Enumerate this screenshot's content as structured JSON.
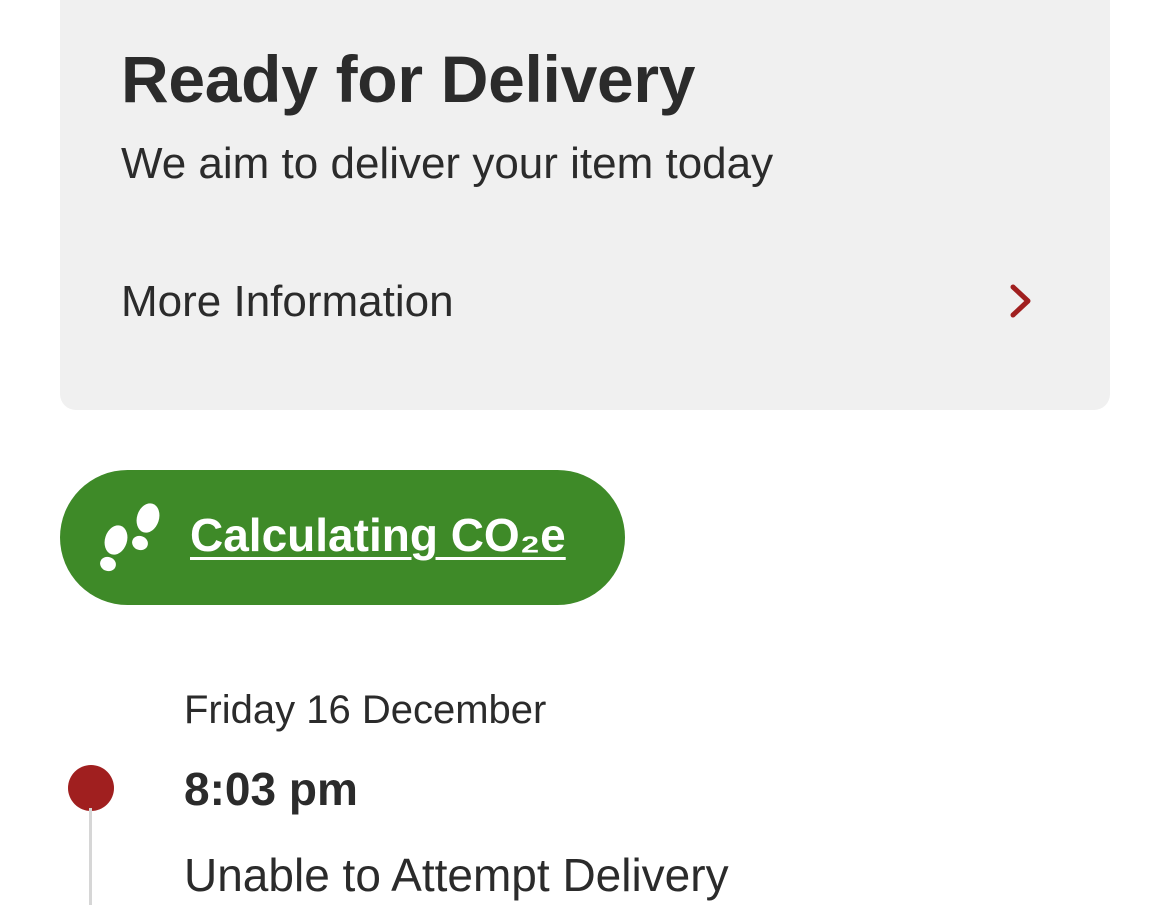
{
  "status_card": {
    "title": "Ready for Delivery",
    "subtitle": "We aim to deliver your item today",
    "more_info_label": "More Information",
    "chevron_icon": "chevron-right-icon",
    "accent_color": "#a01f1f"
  },
  "co2_badge": {
    "label": "Calculating CO₂e",
    "icon": "footprints-icon",
    "background_color": "#3e8a28"
  },
  "timeline": {
    "events": [
      {
        "date": "Friday 16 December",
        "time": "8:03 pm",
        "description": "Unable to Attempt Delivery",
        "dot_color": "#a01f1f"
      }
    ]
  }
}
